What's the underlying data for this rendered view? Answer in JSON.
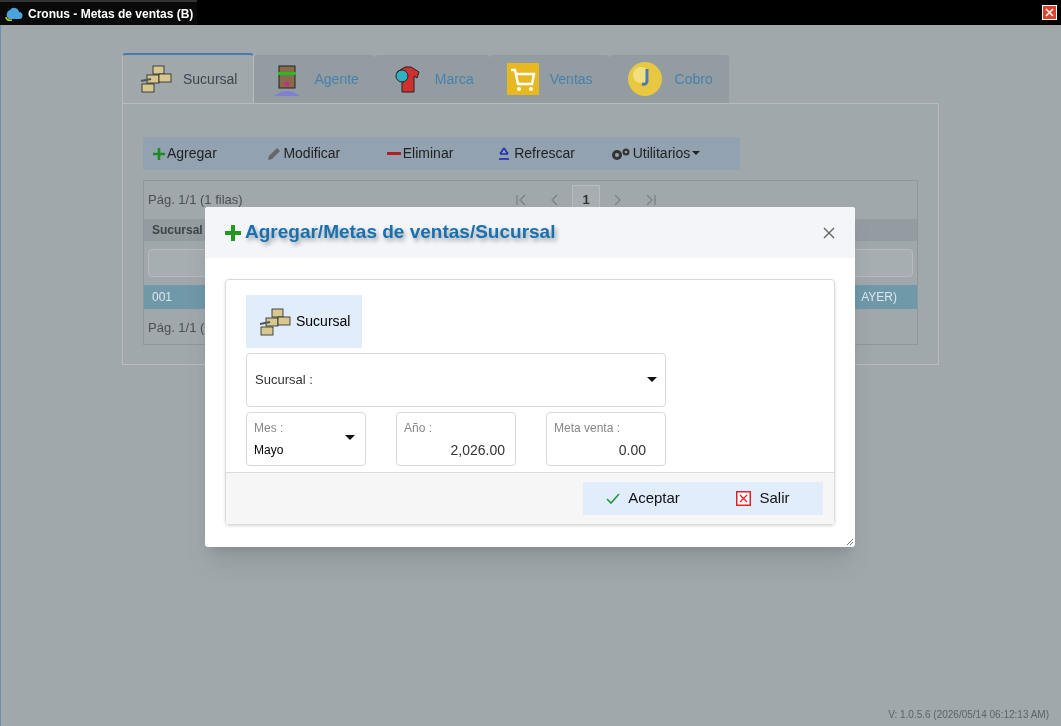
{
  "window": {
    "title": "Cronus - Metas de ventas (B)"
  },
  "tabs": [
    {
      "label": "Sucursal",
      "selected": true,
      "kind": "branch"
    },
    {
      "label": "Agente",
      "selected": false,
      "kind": "agent"
    },
    {
      "label": "Marca",
      "selected": false,
      "kind": "brand"
    },
    {
      "label": "Ventas",
      "selected": false,
      "kind": "sales"
    },
    {
      "label": "Cobro",
      "selected": false,
      "kind": "collect"
    }
  ],
  "toolbar": [
    {
      "label": "Agregar",
      "kind": "add"
    },
    {
      "label": "Modificar",
      "kind": "edit"
    },
    {
      "label": "Eliminar",
      "kind": "delete"
    },
    {
      "label": "Refrescar",
      "kind": "refresh"
    },
    {
      "label": "Utilitarios",
      "kind": "utilities"
    }
  ],
  "grid": {
    "pager_text": "Pág. 1/1 (1 filas)",
    "page": "1",
    "column_1": "Sucursal",
    "rows": [
      {
        "column_1": "001",
        "column_2": "AYER)",
        "selected": true
      }
    ],
    "footer_text": "Pág. 1/1 ("
  },
  "dialog": {
    "title": "Agregar/Metas de ventas/Sucursal",
    "section": "Sucursal",
    "sucursal": {
      "label": "Sucursal :"
    },
    "mes": {
      "label": "Mes :",
      "value": "Mayo"
    },
    "anio": {
      "label": "Año :",
      "value": "2,026.00"
    },
    "meta": {
      "label": "Meta venta :",
      "value": "0.00"
    },
    "buttons": [
      {
        "label": "Aceptar",
        "kind": "ok"
      },
      {
        "label": "Salir",
        "kind": "exit"
      }
    ]
  },
  "version": "V: 1.0.5.6 (2026/05/14 06:12:13 AM)"
}
